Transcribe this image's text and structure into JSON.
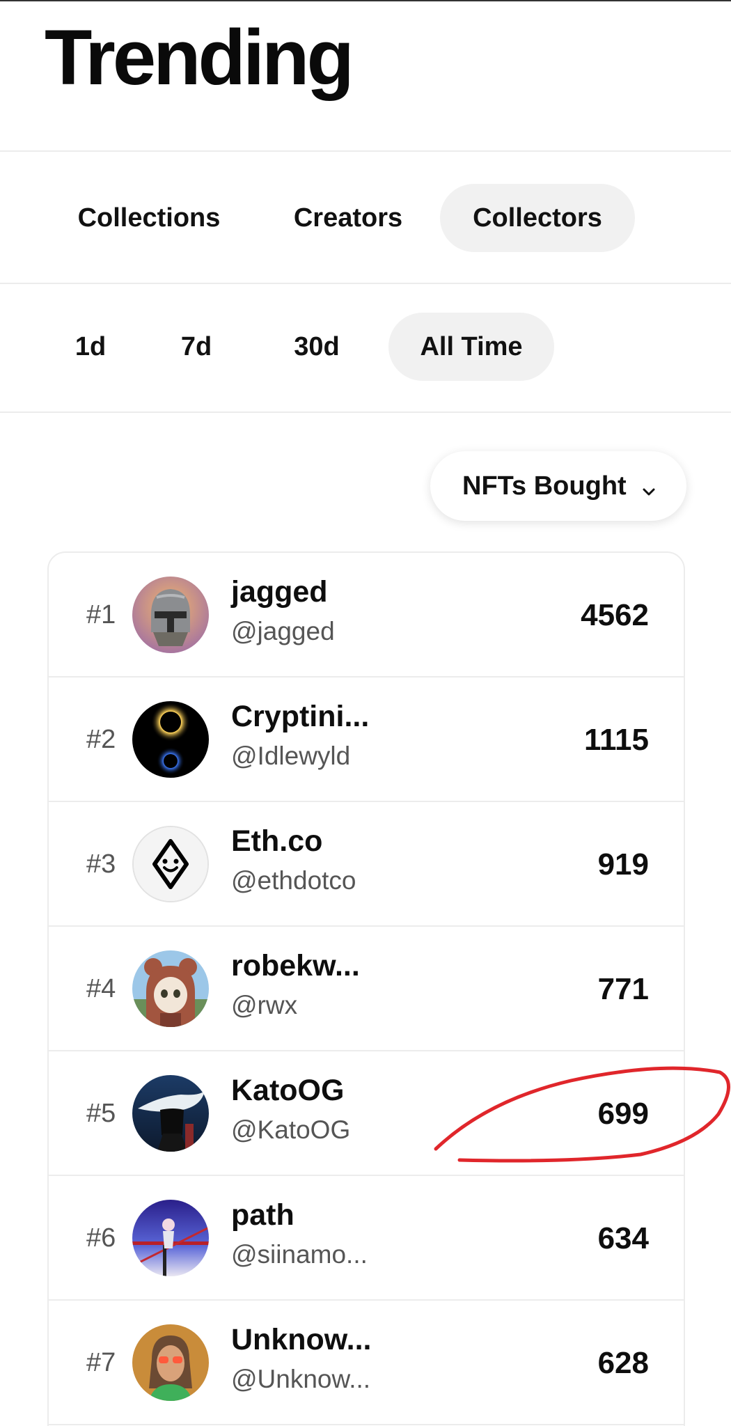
{
  "header": {
    "title": "Trending"
  },
  "category_tabs": [
    {
      "label": "Collections",
      "active": false
    },
    {
      "label": "Creators",
      "active": false
    },
    {
      "label": "Collectors",
      "active": true
    }
  ],
  "time_tabs": [
    {
      "label": "1d",
      "active": false
    },
    {
      "label": "7d",
      "active": false
    },
    {
      "label": "30d",
      "active": false
    },
    {
      "label": "All Time",
      "active": true
    }
  ],
  "sort_dropdown": {
    "selected": "NFTs Bought",
    "icon": "chevron-down-icon"
  },
  "collectors": [
    {
      "rank": "#1",
      "name": "jagged",
      "handle": "@jagged",
      "value": "4562",
      "avatar": "helmet-avatar"
    },
    {
      "rank": "#2",
      "name": "Cryptini...",
      "handle": "@Idlewyld",
      "value": "1115",
      "avatar": "eclipse-avatar"
    },
    {
      "rank": "#3",
      "name": "Eth.co",
      "handle": "@ethdotco",
      "value": "919",
      "avatar": "diamond-face-logo"
    },
    {
      "rank": "#4",
      "name": "robekw...",
      "handle": "@rwx",
      "value": "771",
      "avatar": "bear-hood-avatar"
    },
    {
      "rank": "#5",
      "name": "KatoOG",
      "handle": "@KatoOG",
      "value": "699",
      "avatar": "cowboy-avatar"
    },
    {
      "rank": "#6",
      "name": "path",
      "handle": "@siinamo...",
      "value": "634",
      "avatar": "anime-avatar"
    },
    {
      "rank": "#7",
      "name": "Unknow...",
      "handle": "@Unknow...",
      "value": "628",
      "avatar": "portrait-avatar"
    }
  ],
  "colors": {
    "active_pill": "#f1f1f1",
    "annotation_red": "#e0262b",
    "divider": "#ececec"
  }
}
